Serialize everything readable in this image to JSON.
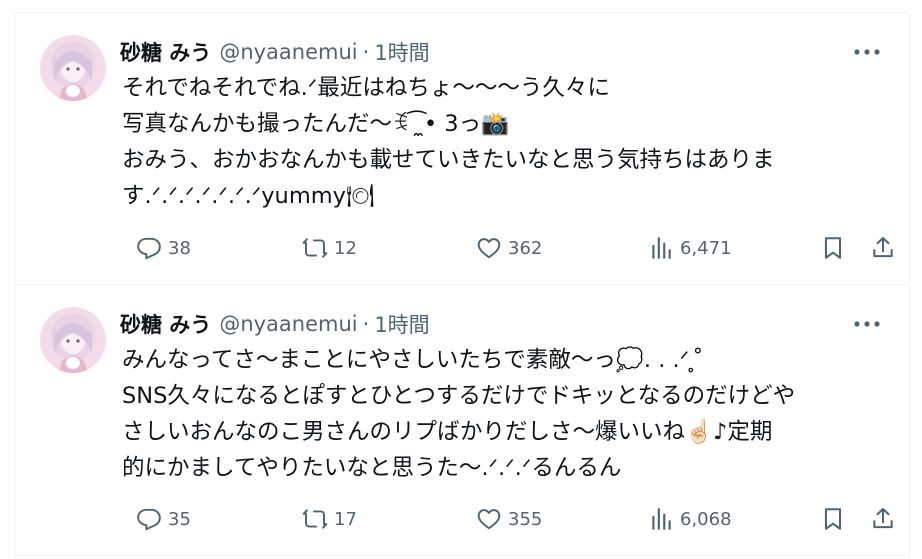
{
  "tweets": [
    {
      "display_name": "砂糖 みう",
      "handle": "@nyaanemui",
      "separator": "·",
      "time": "1時間",
      "lines": [
        "それでねそれでね.ᐟ最近はねちょ〜〜〜う久々に",
        "写真なんかも撮ったんだ〜ꉂ ͡ ̼• 3っ📸",
        "おみう、おかおなんかも載せていきたいなと思う気持ちはありま",
        "す.ᐟ.ᐟ.ᐟ.ᐟ.ᐟ.ᐟ.ᐟyummy🍽"
      ],
      "replies": "38",
      "reposts": "12",
      "likes": "362",
      "views": "6,471"
    },
    {
      "display_name": "砂糖 みう",
      "handle": "@nyaanemui",
      "separator": "·",
      "time": "1時間",
      "lines": [
        "みんなってさ〜まことにやさしいたちで素敵〜っ💭. . .ᐟ ̥ ̊",
        "SNS久々になるとぽすとひとつするだけでドキッとなるのだけどや",
        "さしいおんなのこ男さんのリプばかりだしさ〜爆いいね☝🏻♪定期",
        "的にかましてやりたいなと思うた〜.ᐟ.ᐟ.ᐟるんるん"
      ],
      "replies": "35",
      "reposts": "17",
      "likes": "355",
      "views": "6,068"
    }
  ],
  "icons": {
    "more": "more-dots-icon",
    "reply": "reply-icon",
    "repost": "repost-icon",
    "like": "heart-icon",
    "views": "views-chart-icon",
    "bookmark": "bookmark-icon",
    "share": "share-icon"
  },
  "colors": {
    "text": "#0f1419",
    "secondary": "#536471",
    "border": "#eff3f4",
    "avatar_bg": "#f2dcea"
  }
}
